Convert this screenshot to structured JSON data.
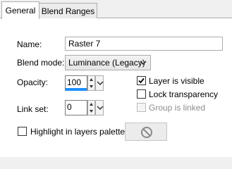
{
  "tabs": [
    {
      "label": "General",
      "active": true
    },
    {
      "label": "Blend Ranges",
      "active": false
    }
  ],
  "name": {
    "label": "Name:",
    "value": "Raster 7"
  },
  "blend_mode": {
    "label": "Blend mode:",
    "value": "Luminance (Legacy)"
  },
  "opacity": {
    "label": "Opacity:",
    "value": "100",
    "level_percent": 100
  },
  "link_set": {
    "label": "Link set:",
    "value": "0"
  },
  "checkboxes": {
    "layer_visible": {
      "label": "Layer is visible",
      "checked": true,
      "enabled": true
    },
    "lock_transparency": {
      "label": "Lock transparency",
      "checked": false,
      "enabled": true
    },
    "group_linked": {
      "label": "Group is linked",
      "checked": false,
      "enabled": false
    },
    "highlight": {
      "label": "Highlight in layers palette:",
      "checked": false,
      "enabled": true
    }
  },
  "highlight_color_button": {
    "icon": "no-color-icon"
  },
  "colors": {
    "accent": "#1e90ff",
    "disabled_text": "#8d8d8d"
  }
}
